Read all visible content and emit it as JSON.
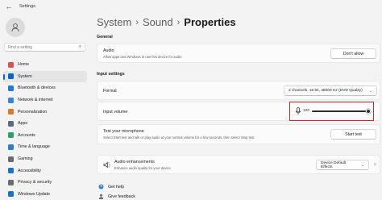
{
  "window": {
    "title": "Settings",
    "back_glyph": "←"
  },
  "user": {
    "avatar_icon": "user-avatar-icon"
  },
  "search": {
    "placeholder": "Find a setting",
    "icon": "search-icon"
  },
  "nav": [
    {
      "label": "Home",
      "icon": "home-icon",
      "color": "#d9534f"
    },
    {
      "label": "System",
      "icon": "system-icon",
      "color": "#0067c0",
      "selected": true
    },
    {
      "label": "Bluetooth & devices",
      "icon": "bluetooth-icon",
      "color": "#1c7cd5"
    },
    {
      "label": "Network & internet",
      "icon": "network-icon",
      "color": "#3a86d6"
    },
    {
      "label": "Personalization",
      "icon": "brush-icon",
      "color": "#d87a2b"
    },
    {
      "label": "Apps",
      "icon": "apps-icon",
      "color": "#5a6c85"
    },
    {
      "label": "Accounts",
      "icon": "accounts-icon",
      "color": "#2f9e6e"
    },
    {
      "label": "Time & language",
      "icon": "time-language-icon",
      "color": "#2a7fd4"
    },
    {
      "label": "Gaming",
      "icon": "gaming-icon",
      "color": "#6b6b6b"
    },
    {
      "label": "Accessibility",
      "icon": "accessibility-icon",
      "color": "#1a73c6"
    },
    {
      "label": "Privacy & security",
      "icon": "shield-icon",
      "color": "#6d6d6d"
    },
    {
      "label": "Windows Update",
      "icon": "windows-update-icon",
      "color": "#1a73c6"
    }
  ],
  "breadcrumb": {
    "items": [
      "System",
      "Sound",
      "Properties"
    ],
    "separator": "›"
  },
  "general": {
    "heading": "General",
    "audio": {
      "title": "Audio",
      "subtitle": "Allow apps and Windows to use this device for audio",
      "button": "Don't allow"
    }
  },
  "input_settings": {
    "heading": "Input settings",
    "format": {
      "title": "Format",
      "value": "2 channels, 16 bit, 48000 Hz (DVD Quality)"
    },
    "volume": {
      "title": "Input volume",
      "value": "100",
      "level": 1.0,
      "icon": "microphone-icon"
    },
    "test": {
      "title": "Test your microphone",
      "subtitle": "Select Start test and talk or play audio at your normal volume for a few seconds, then select Stop test",
      "button": "Start test"
    },
    "enhancements": {
      "title": "Audio enhancements",
      "subtitle": "Enhance audio quality for your device",
      "value": "Device Default Effects",
      "icon": "audio-enhancements-icon"
    }
  },
  "footer": {
    "help": {
      "label": "Get help",
      "icon": "help-icon"
    },
    "feedback": {
      "label": "Give feedback",
      "icon": "feedback-icon"
    }
  },
  "colors": {
    "accent": "#0067c0",
    "highlight_box": "#d81e2a"
  }
}
